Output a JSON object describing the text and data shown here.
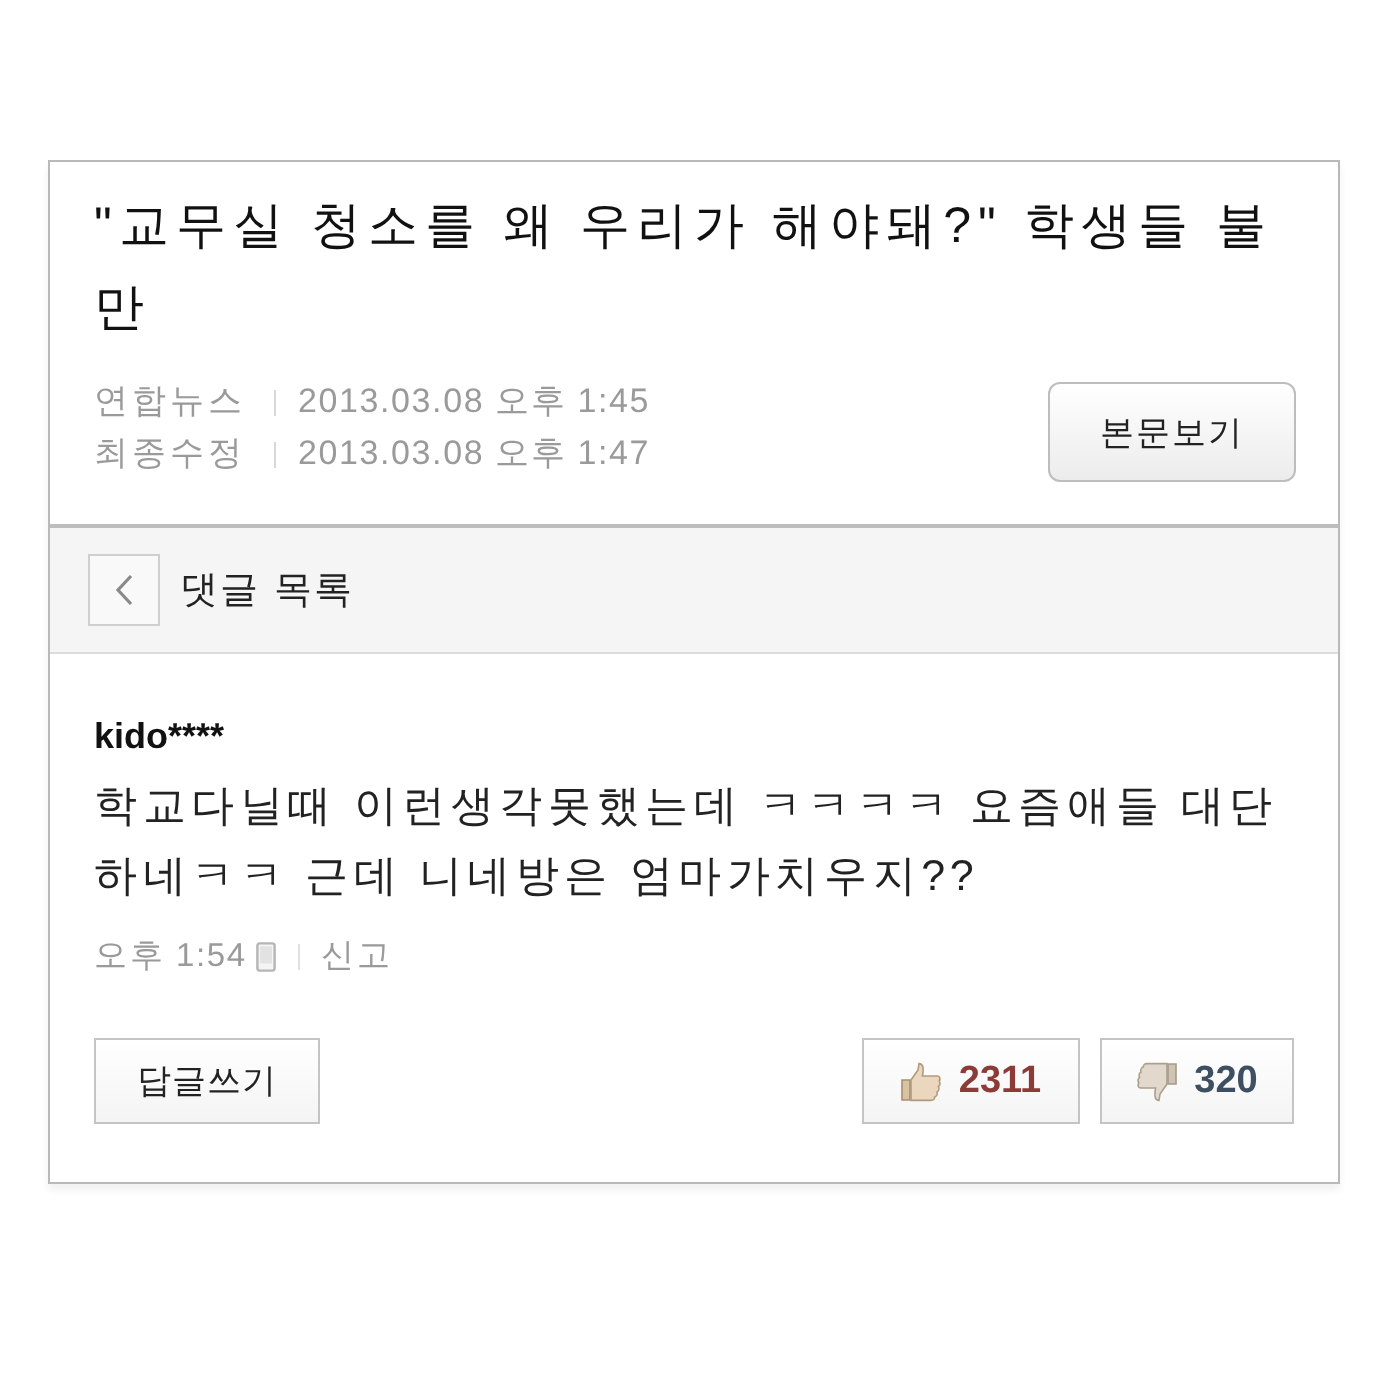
{
  "article": {
    "title": "\"교무실 청소를 왜 우리가 해야돼?\" 학생들 불만",
    "meta": [
      {
        "label": "연합뉴스",
        "date": "2013.03.08 오후 1:45"
      },
      {
        "label": "최종수정",
        "date": "2013.03.08 오후 1:47"
      }
    ],
    "view_button": "본문보기"
  },
  "comments_header": {
    "title": "댓글 목록"
  },
  "comments": [
    {
      "author": "kido****",
      "body": "학교다닐때 이런생각못했는데 ㅋㅋㅋㅋ 요즘애들 대단하네ㅋㅋ 근데 니네방은 엄마가치우지??",
      "time": "오후 1:54",
      "report": "신고",
      "reply_button": "답글쓰기",
      "likes": "2311",
      "dislikes": "320"
    }
  ]
}
